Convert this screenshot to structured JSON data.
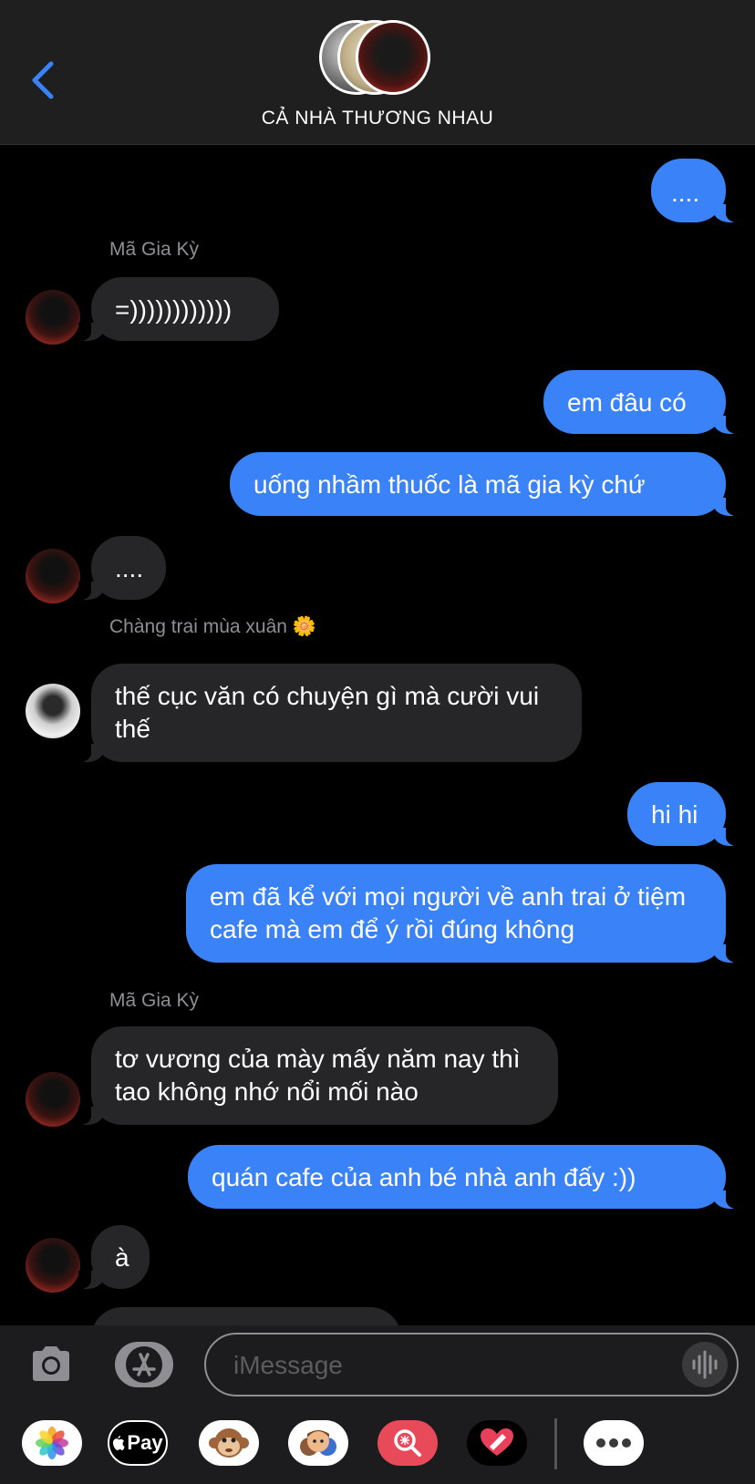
{
  "header": {
    "title": "CẢ NHÀ THƯƠNG NHAU"
  },
  "chat": {
    "messages": [
      {
        "from": "me",
        "text": "...."
      },
      {
        "sender": "Mã Gia Kỳ"
      },
      {
        "from": "them",
        "text": "=))))))))))))"
      },
      {
        "from": "me",
        "text": "em đâu có"
      },
      {
        "from": "me",
        "text": "uống nhầm thuốc là mã gia kỳ chứ"
      },
      {
        "from": "them",
        "text": "...."
      },
      {
        "sender": "Chàng trai mùa xuân 🌼"
      },
      {
        "from": "them",
        "text": "thế cục văn có chuyện gì mà cười vui thế"
      },
      {
        "from": "me",
        "text": "hi hi"
      },
      {
        "from": "me",
        "text": "em đã kể với mọi người về anh trai ở tiệm cafe mà em để ý rồi đúng không"
      },
      {
        "sender": "Mã Gia Kỳ"
      },
      {
        "from": "them",
        "text": "tơ vương của mày mấy năm nay thì tao không nhớ nổi mối nào"
      },
      {
        "from": "me",
        "text": "quán cafe của anh bé nhà anh đấy :))"
      },
      {
        "from": "them",
        "text": "à"
      }
    ]
  },
  "composer": {
    "placeholder": "iMessage"
  },
  "tray": {
    "apple_pay_label": "Pay"
  },
  "colors": {
    "my_bubble": "#3a82f7",
    "their_bubble": "#262628",
    "header_bg": "#1f1f1f",
    "back_chevron": "#3a82f7"
  },
  "icons": [
    "back-chevron-icon",
    "camera-icon",
    "app-store-icon",
    "audio-waveform-icon",
    "photos-icon",
    "apple-pay-icon",
    "animoji-monkey-icon",
    "memoji-icon",
    "image-search-icon",
    "digital-touch-icon",
    "more-icon"
  ]
}
